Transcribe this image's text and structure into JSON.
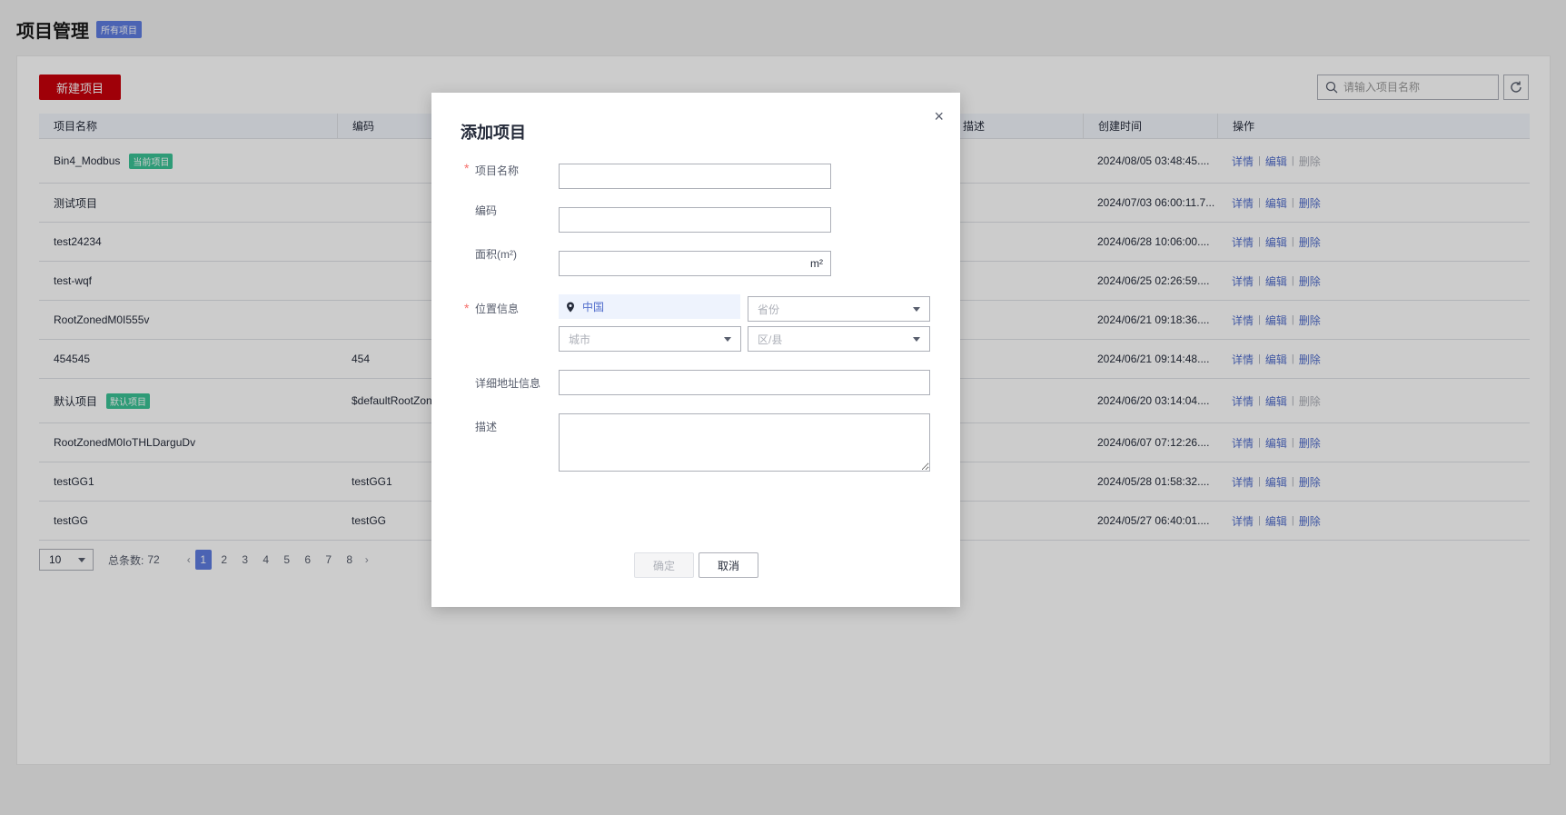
{
  "page": {
    "title": "项目管理",
    "badge": "所有项目"
  },
  "toolbar": {
    "new_button": "新建项目",
    "search_placeholder": "请输入项目名称"
  },
  "table": {
    "columns": [
      "项目名称",
      "编码",
      "描述",
      "创建时间",
      "操作"
    ],
    "rows": [
      {
        "name": "Bin4_Modbus",
        "tag": "当前项目",
        "code": "",
        "created": "2024/08/05 03:48:45....",
        "ops": [
          "详情",
          "编辑",
          "删除"
        ],
        "delete_disabled": true
      },
      {
        "name": "测试项目",
        "tag": "",
        "code": "",
        "created": "2024/07/03 06:00:11.7...",
        "ops": [
          "详情",
          "编辑",
          "删除"
        ],
        "delete_disabled": false
      },
      {
        "name": "test24234",
        "tag": "",
        "code": "",
        "created": "2024/06/28 10:06:00....",
        "ops": [
          "详情",
          "编辑",
          "删除"
        ],
        "delete_disabled": false
      },
      {
        "name": "test-wqf",
        "tag": "",
        "code": "",
        "created": "2024/06/25 02:26:59....",
        "ops": [
          "详情",
          "编辑",
          "删除"
        ],
        "delete_disabled": false
      },
      {
        "name": "RootZonedM0I555v",
        "tag": "",
        "code": "",
        "created": "2024/06/21 09:18:36....",
        "ops": [
          "详情",
          "编辑",
          "删除"
        ],
        "delete_disabled": false
      },
      {
        "name": "454545",
        "tag": "",
        "code": "454",
        "created": "2024/06/21 09:14:48....",
        "ops": [
          "详情",
          "编辑",
          "删除"
        ],
        "delete_disabled": false
      },
      {
        "name": "默认项目",
        "tag": "默认项目",
        "code": "$defaultRootZon",
        "created": "2024/06/20 03:14:04....",
        "ops": [
          "详情",
          "编辑",
          "删除"
        ],
        "delete_disabled": true
      },
      {
        "name": "RootZonedM0IoTHLDarguDv",
        "tag": "",
        "code": "",
        "created": "2024/06/07 07:12:26....",
        "ops": [
          "详情",
          "编辑",
          "删除"
        ],
        "delete_disabled": false
      },
      {
        "name": "testGG1",
        "tag": "",
        "code": "testGG1",
        "created": "2024/05/28 01:58:32....",
        "ops": [
          "详情",
          "编辑",
          "删除"
        ],
        "delete_disabled": false
      },
      {
        "name": "testGG",
        "tag": "",
        "code": "testGG",
        "created": "2024/05/27 06:40:01....",
        "ops": [
          "详情",
          "编辑",
          "删除"
        ],
        "delete_disabled": false
      }
    ]
  },
  "pagination": {
    "page_size": "10",
    "total_label": "总条数:",
    "total": "72",
    "pages": [
      "1",
      "2",
      "3",
      "4",
      "5",
      "6",
      "7",
      "8"
    ],
    "current": "1",
    "prev": "‹",
    "next": "›"
  },
  "modal": {
    "title": "添加项目",
    "close": "×",
    "fields": {
      "name_label": "项目名称",
      "code_label": "编码",
      "area_label": "面积(m²)",
      "area_unit": "m²",
      "location_label": "位置信息",
      "country": "中国",
      "province_placeholder": "省份",
      "city_placeholder": "城市",
      "district_placeholder": "区/县",
      "address_label": "详细地址信息",
      "desc_label": "描述"
    },
    "required_mark": "*",
    "ok_button": "确定",
    "cancel_button": "取消"
  },
  "colors": {
    "primary_red": "#c7000b",
    "brand_blue": "#5e7ce0",
    "link_blue": "#526ecc",
    "tag_green": "#3ac295"
  }
}
